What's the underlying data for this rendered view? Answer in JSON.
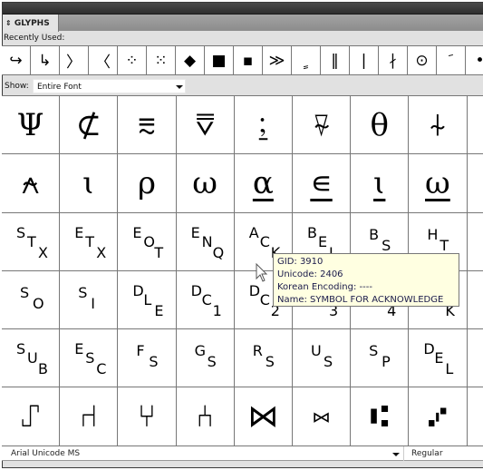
{
  "panel": {
    "tab_label": "GLYPHS",
    "tab_icon": "collapse-arrows-icon"
  },
  "recently_used": {
    "label": "Recently Used:",
    "glyphs": [
      "↪",
      "↳",
      "〉",
      "〈",
      "⁘",
      "⁙",
      "◆",
      "■",
      "▪",
      "≫",
      "ﹴ",
      "‖",
      "|",
      "∤",
      "⊙",
      "ﹶ",
      "•"
    ]
  },
  "show": {
    "label": "Show:",
    "value": "Entire Font"
  },
  "grid": {
    "rows": [
      [
        {
          "glyph": "Ψ",
          "type": "text"
        },
        {
          "glyph": "⊄",
          "type": "text"
        },
        {
          "glyph": "⩳",
          "type": "text"
        },
        {
          "glyph": "⩢",
          "type": "text"
        },
        {
          "glyph": "⍮",
          "type": "text"
        },
        {
          "glyph": "⍫",
          "type": "text"
        },
        {
          "glyph": "θ",
          "type": "text"
        },
        {
          "glyph": "⍭",
          "type": "text"
        },
        {
          "glyph": "",
          "type": "text"
        }
      ],
      [
        {
          "glyph": "⍲",
          "type": "text"
        },
        {
          "glyph": "ɩ",
          "type": "text"
        },
        {
          "glyph": "ρ",
          "type": "text"
        },
        {
          "glyph": "ω",
          "type": "text"
        },
        {
          "glyph": "α",
          "type": "under"
        },
        {
          "glyph": "∊",
          "type": "under"
        },
        {
          "glyph": "ɩ",
          "type": "under"
        },
        {
          "glyph": "ω",
          "type": "under"
        },
        {
          "glyph": "",
          "type": "text"
        }
      ],
      [
        {
          "type": "ctrl",
          "parts": [
            "S",
            "T",
            "X"
          ]
        },
        {
          "type": "ctrl",
          "parts": [
            "E",
            "T",
            "X"
          ]
        },
        {
          "type": "ctrl",
          "parts": [
            "E",
            "O",
            "T"
          ]
        },
        {
          "type": "ctrl",
          "parts": [
            "E",
            "N",
            "Q"
          ]
        },
        {
          "type": "ctrl",
          "parts": [
            "A",
            "C",
            "K"
          ]
        },
        {
          "type": "ctrl",
          "parts": [
            "B",
            "E",
            "L"
          ]
        },
        {
          "type": "ctrl",
          "parts": [
            "B",
            "S",
            ""
          ]
        },
        {
          "type": "ctrl",
          "parts": [
            "H",
            "T",
            ""
          ]
        },
        {
          "glyph": "",
          "type": "text"
        }
      ],
      [
        {
          "type": "ctrl",
          "parts": [
            "S",
            "O",
            ""
          ]
        },
        {
          "type": "ctrl",
          "parts": [
            "S",
            "I",
            ""
          ]
        },
        {
          "type": "ctrl",
          "parts": [
            "D",
            "L",
            "E"
          ]
        },
        {
          "type": "ctrl",
          "parts": [
            "D",
            "C",
            "1"
          ]
        },
        {
          "type": "ctrl",
          "parts": [
            "D",
            "C",
            "2"
          ]
        },
        {
          "type": "ctrl",
          "parts": [
            "D",
            "C",
            "3"
          ]
        },
        {
          "type": "ctrl",
          "parts": [
            "D",
            "C",
            "4"
          ]
        },
        {
          "type": "ctrl",
          "parts": [
            "N",
            "A",
            "K"
          ]
        },
        {
          "glyph": "",
          "type": "text"
        }
      ],
      [
        {
          "type": "ctrl",
          "parts": [
            "S",
            "U",
            "B"
          ]
        },
        {
          "type": "ctrl",
          "parts": [
            "E",
            "S",
            "C"
          ]
        },
        {
          "type": "ctrl",
          "parts": [
            "F",
            "S",
            ""
          ]
        },
        {
          "type": "ctrl",
          "parts": [
            "G",
            "S",
            ""
          ]
        },
        {
          "type": "ctrl",
          "parts": [
            "R",
            "S",
            ""
          ]
        },
        {
          "type": "ctrl",
          "parts": [
            "U",
            "S",
            ""
          ]
        },
        {
          "type": "ctrl",
          "parts": [
            "S",
            "P",
            ""
          ]
        },
        {
          "type": "ctrl",
          "parts": [
            "D",
            "E",
            "L"
          ]
        },
        {
          "glyph": "",
          "type": "text"
        }
      ],
      [
        {
          "glyph": "⑀",
          "type": "text"
        },
        {
          "glyph": "⑁",
          "type": "text"
        },
        {
          "glyph": "⑂",
          "type": "text"
        },
        {
          "glyph": "⑃",
          "type": "text"
        },
        {
          "glyph": "⋈",
          "type": "text"
        },
        {
          "glyph": "⑅",
          "type": "text"
        },
        {
          "glyph": "⑆",
          "type": "text"
        },
        {
          "glyph": "⑇",
          "type": "text"
        },
        {
          "glyph": "",
          "type": "text"
        }
      ]
    ]
  },
  "tooltip": {
    "gid": "GID: 3910",
    "unicode": "Unicode: 2406",
    "korean_encoding": "Korean Encoding: ----",
    "name": "Name: SYMBOL FOR ACKNOWLEDGE"
  },
  "footer": {
    "font_family": "Arial Unicode MS",
    "font_style": "Regular"
  }
}
